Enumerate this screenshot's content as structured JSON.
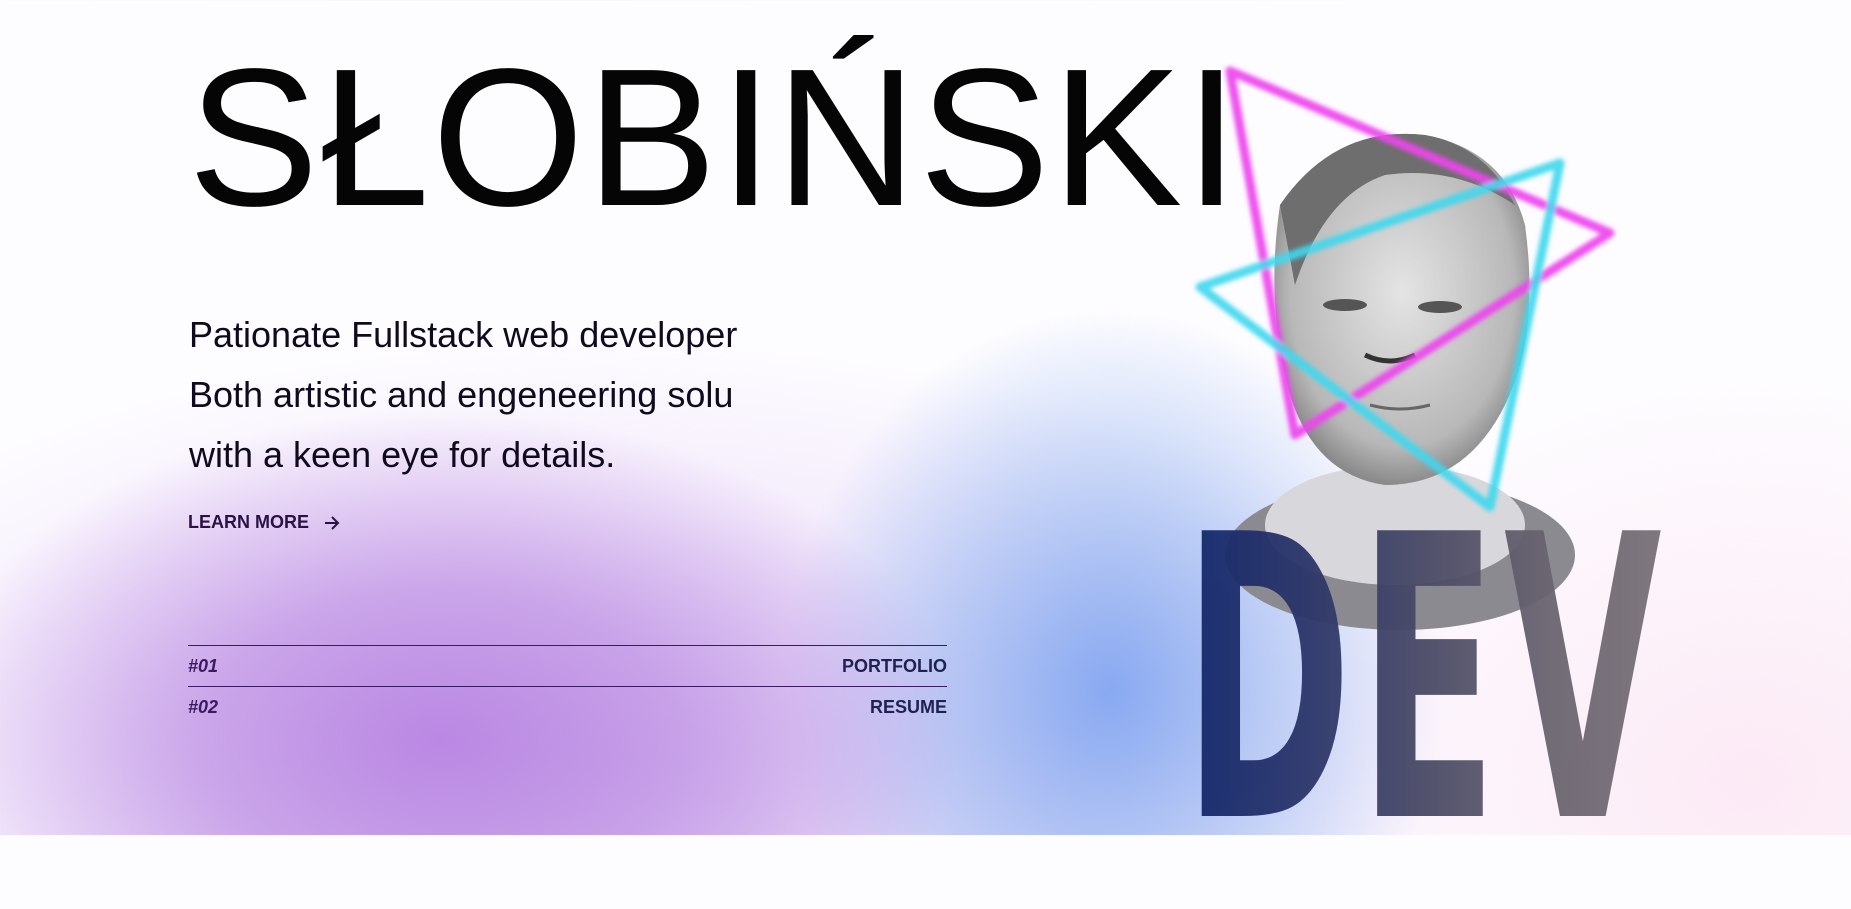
{
  "header": {
    "title": "SŁOBIŃSKI"
  },
  "hero": {
    "lines": [
      "Pationate Fullstack web developer",
      "Both artistic and engeneering solu",
      "with a keen eye for details."
    ],
    "learn_more": "LEARN MORE",
    "arrow_icon": "arrow-right-icon"
  },
  "nav": [
    {
      "num": "#01",
      "label": "PORTFOLIO"
    },
    {
      "num": "#02",
      "label": "RESUME"
    }
  ],
  "portrait": {
    "overlay_text": "DEV"
  },
  "colors": {
    "magenta": "#ee44ee",
    "cyan": "#3fd8ee",
    "purple_blob": "#bb88e2",
    "blue_blob": "#8eaaf0"
  }
}
